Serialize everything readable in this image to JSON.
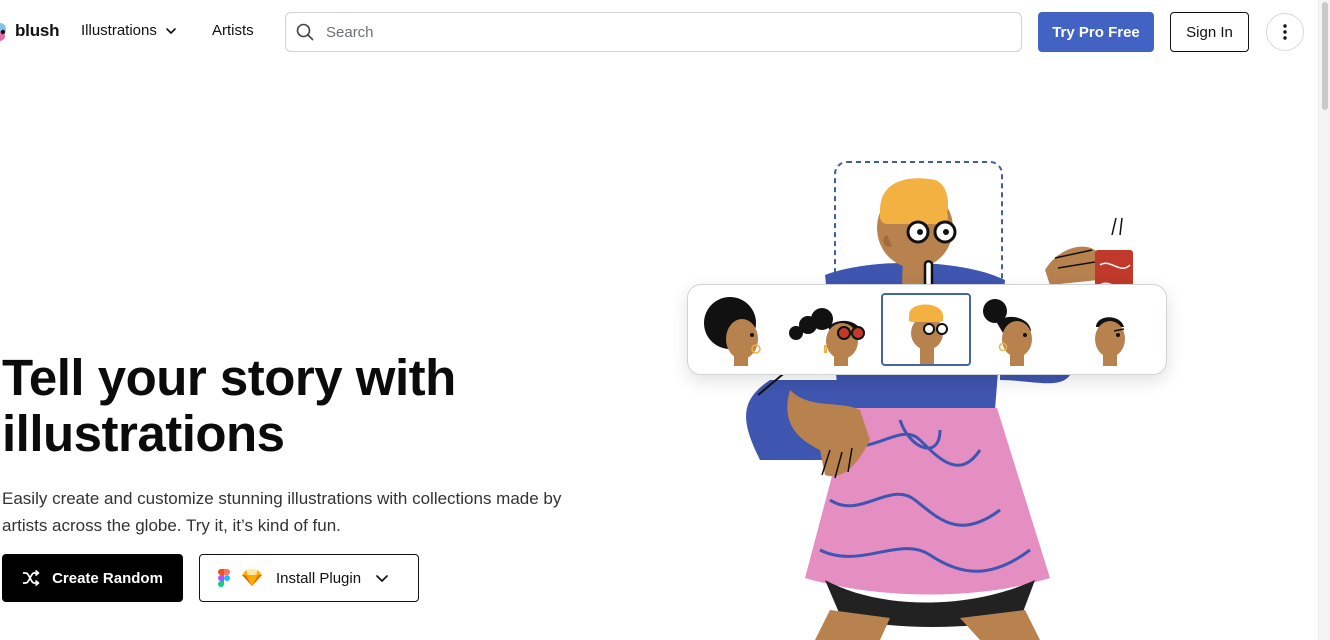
{
  "header": {
    "logo_text": "blush",
    "nav": {
      "illustrations_label": "Illustrations",
      "artists_label": "Artists"
    },
    "search_placeholder": "Search",
    "try_pro_label": "Try Pro Free",
    "sign_in_label": "Sign In"
  },
  "hero": {
    "title": "Tell your story with illustrations",
    "subtitle": "Easily create and customize stunning illustrations with collections made by artists across the globe. Try it, it’s kind of fun.",
    "create_random_label": "Create Random",
    "install_plugin_label": "Install Plugin"
  },
  "illustration": {
    "picker_options": [
      "afro-head",
      "space-buns-sunglasses-head",
      "beanie-glasses-head",
      "top-bun-head",
      "short-hair-head"
    ],
    "selected_index": 2
  },
  "colors": {
    "accent": "#4263c4",
    "skin": "#b8824f",
    "shirt": "#3f56b0",
    "skirt": "#e48ec2",
    "beanie": "#f2b140",
    "cup": "#c0392b"
  }
}
